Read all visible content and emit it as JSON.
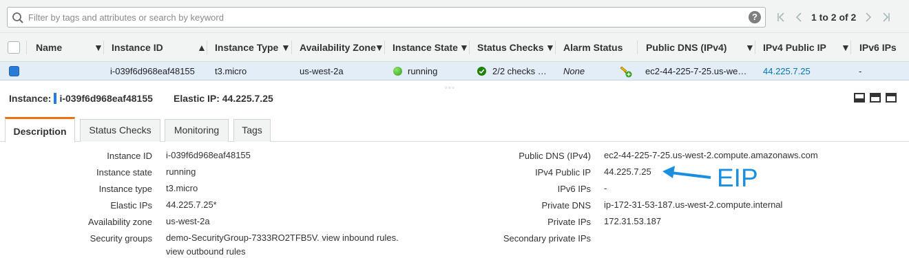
{
  "filter": {
    "placeholder": "Filter by tags and attributes or search by keyword",
    "help_label": "?"
  },
  "pagination": {
    "range": "1 to 2 of 2"
  },
  "table": {
    "columns": [
      "Name",
      "Instance ID",
      "Instance Type",
      "Availability Zone",
      "Instance State",
      "Status Checks",
      "Alarm Status",
      "Public DNS (IPv4)",
      "IPv4 Public IP",
      "IPv6 IPs"
    ],
    "row": {
      "name": "",
      "instance_id": "i-039f6d968eaf48155",
      "instance_type": "t3.micro",
      "availability_zone": "us-west-2a",
      "instance_state": "running",
      "status_checks": "2/2 checks …",
      "alarm_status": "None",
      "public_dns": "ec2-44-225-7-25.us-we…",
      "ipv4_public_ip": "44.225.7.25",
      "ipv6_ips": "-"
    }
  },
  "summary": {
    "instance_label": "Instance:",
    "instance_id": "i-039f6d968eaf48155",
    "elastic_ip": "Elastic IP: 44.225.7.25"
  },
  "tabs": [
    "Description",
    "Status Checks",
    "Monitoring",
    "Tags"
  ],
  "details": {
    "left": [
      {
        "label": "Instance ID",
        "value": "i-039f6d968eaf48155"
      },
      {
        "label": "Instance state",
        "value": "running"
      },
      {
        "label": "Instance type",
        "value": "t3.micro"
      },
      {
        "label": "Elastic IPs",
        "value": "44.225.7.25*"
      },
      {
        "label": "Availability zone",
        "value": "us-west-2a"
      },
      {
        "label": "Security groups",
        "value": "demo-SecurityGroup-7333RO2TFB5V.",
        "value_extra": "view inbound rules.",
        "value_line2": "view outbound rules"
      }
    ],
    "right": [
      {
        "label": "Public DNS (IPv4)",
        "value": "ec2-44-225-7-25.us-west-2.compute.amazonaws.com"
      },
      {
        "label": "IPv4 Public IP",
        "value": "44.225.7.25"
      },
      {
        "label": "IPv6 IPs",
        "value": "-"
      },
      {
        "label": "Private DNS",
        "value": "ip-172-31-53-187.us-west-2.compute.internal"
      },
      {
        "label": "Private IPs",
        "value": "172.31.53.187"
      },
      {
        "label": "Secondary private IPs",
        "value": ""
      }
    ]
  },
  "annotation": {
    "text": "EIP"
  },
  "colors": {
    "accent": "#ec7211",
    "link": "#0073bb",
    "selected_row": "#e3edf8",
    "annotation": "#1a8fe0",
    "running": "#2fa318"
  }
}
